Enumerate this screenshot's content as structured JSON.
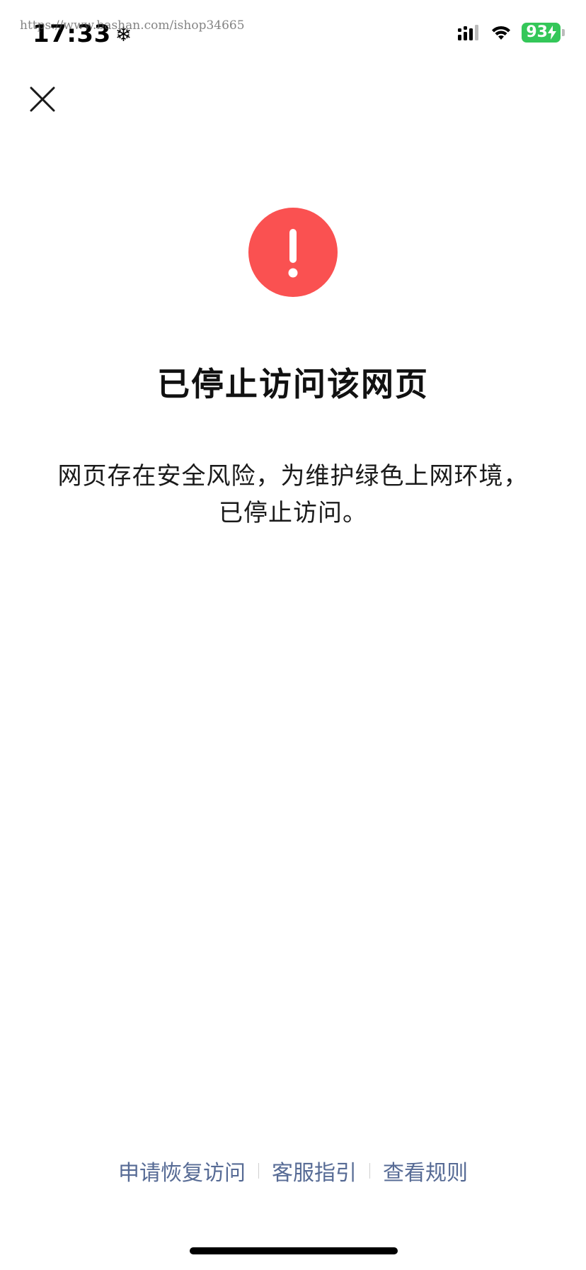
{
  "status_bar": {
    "time": "17:33",
    "time_icon": "snowflake-icon",
    "watermark": "https://www.bashan.com/ishop34665",
    "battery": "93",
    "icons": [
      "cellular-signal-icon",
      "wifi-icon",
      "battery-charging-icon"
    ],
    "battery_color": "#34c759"
  },
  "header": {
    "close_icon": "close-icon"
  },
  "main": {
    "warning_icon": "exclamation-icon",
    "warning_color": "#fa5151",
    "title": "已停止访问该网页",
    "description": "网页存在安全风险，为维护绿色上网环境，已停止访问。"
  },
  "footer": {
    "link_color": "#576b95",
    "links": [
      {
        "label": "申请恢复访问"
      },
      {
        "label": "客服指引"
      },
      {
        "label": "查看规则"
      }
    ]
  }
}
